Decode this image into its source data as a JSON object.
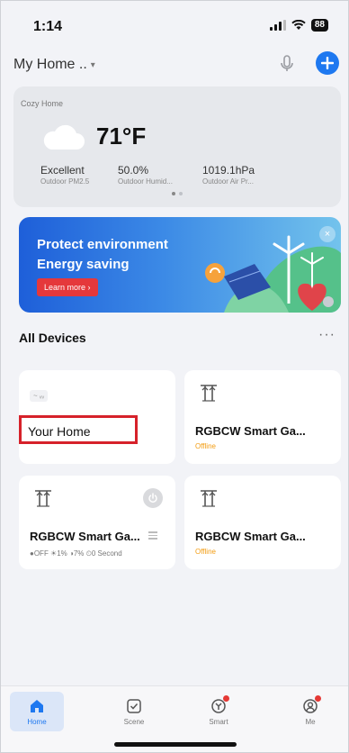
{
  "status_bar": {
    "time": "1:14",
    "battery": "88"
  },
  "header": {
    "home_name": "My Home ..",
    "caret": "▾"
  },
  "weather": {
    "title": "Cozy Home",
    "temperature": "71°F",
    "stats": [
      {
        "value": "Excellent",
        "label": "Outdoor PM2.5"
      },
      {
        "value": "50.0%",
        "label": "Outdoor Humid..."
      },
      {
        "value": "1019.1hPa",
        "label": "Outdoor Air Pr..."
      }
    ]
  },
  "banner": {
    "line1": "Protect environment",
    "line2": "Energy saving",
    "button": "Learn more  ›",
    "close": "×"
  },
  "devices_section": {
    "title": "All Devices",
    "more": "···"
  },
  "devices": [
    {
      "name": "Your Home",
      "sub_icon_text": "~ ᵥᵥ"
    },
    {
      "name": "RGBCW Smart Ga...",
      "status": "Offline"
    },
    {
      "name": "RGBCW Smart Ga...",
      "stats": "●OFF  ☀1%  ◑7%  ⏲0 Second"
    },
    {
      "name": "RGBCW Smart Ga...",
      "status": "Offline"
    }
  ],
  "tabs": [
    {
      "label": "Home",
      "icon": "home-icon",
      "active": true
    },
    {
      "label": "Scene",
      "icon": "scene-icon"
    },
    {
      "label": "Smart",
      "icon": "smart-icon"
    },
    {
      "label": "Me",
      "icon": "me-icon"
    }
  ],
  "colors": {
    "accent": "#1e78f0",
    "offline": "#f39c12",
    "highlight": "#d6212a"
  }
}
